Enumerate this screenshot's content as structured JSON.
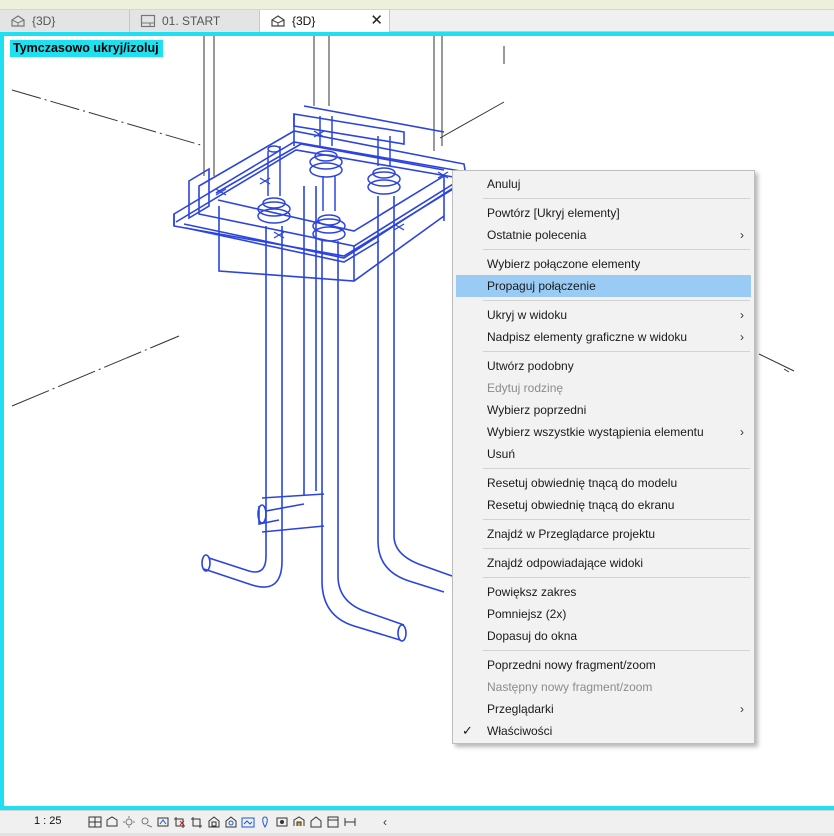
{
  "tabs": [
    {
      "label": "{3D}",
      "icon": "house-3d-icon",
      "active": false
    },
    {
      "label": "01. START",
      "icon": "sheet-icon",
      "active": false
    },
    {
      "label": "{3D}",
      "icon": "house-3d-icon",
      "active": true,
      "close": "✕"
    }
  ],
  "viewport": {
    "isolate_label": "Tymczasowo ukryj/izoluj",
    "border_color": "#1ee0f0",
    "model_color": "#2b44e0"
  },
  "context_menu": {
    "items": [
      {
        "label": "Anuluj"
      },
      {
        "sep": true
      },
      {
        "label": "Powtórz [Ukryj elementy]"
      },
      {
        "label": "Ostatnie polecenia",
        "submenu": "›"
      },
      {
        "sep": true
      },
      {
        "label": "Wybierz połączone elementy"
      },
      {
        "label": "Propaguj połączenie",
        "highlighted": true
      },
      {
        "sep": true
      },
      {
        "label": "Ukryj w widoku",
        "submenu": "›"
      },
      {
        "label": "Nadpisz elementy graficzne w widoku",
        "submenu": "›"
      },
      {
        "sep": true
      },
      {
        "label": "Utwórz podobny"
      },
      {
        "label": "Edytuj rodzinę",
        "disabled": true
      },
      {
        "label": "Wybierz poprzedni"
      },
      {
        "label": "Wybierz wszystkie wystąpienia elementu",
        "submenu": "›"
      },
      {
        "label": "Usuń"
      },
      {
        "sep": true
      },
      {
        "label": "Resetuj obwiednię tnącą do modelu"
      },
      {
        "label": "Resetuj obwiednię tnącą do ekranu"
      },
      {
        "sep": true
      },
      {
        "label": "Znajdź w Przeglądarce projektu"
      },
      {
        "sep": true
      },
      {
        "label": "Znajdź odpowiadające widoki"
      },
      {
        "sep": true
      },
      {
        "label": "Powiększ zakres"
      },
      {
        "label": "Pomniejsz (2x)"
      },
      {
        "label": "Dopasuj do okna"
      },
      {
        "sep": true
      },
      {
        "label": "Poprzedni nowy fragment/zoom"
      },
      {
        "label": "Następny nowy fragment/zoom",
        "disabled": true
      },
      {
        "label": "Przeglądarki",
        "submenu": "›"
      },
      {
        "label": "Właściwości",
        "checked": true,
        "check": "✓"
      }
    ]
  },
  "statusbar": {
    "scale": "1 : 25",
    "icons": [
      "detail-level-icon",
      "visual-style-icon",
      "sun-path-icon",
      "shadows-icon",
      "render-icon",
      "crop-view-icon",
      "show-crop-icon",
      "unlock-3d-icon",
      "temporary-hide-icon",
      "reveal-hidden-icon",
      "worksharing-icon",
      "analytical-model-icon",
      "highlight-displacement-icon",
      "reveal-constraints-icon",
      "temporary-view-icon",
      "3d-view-lock-icon"
    ],
    "more": "‹"
  }
}
